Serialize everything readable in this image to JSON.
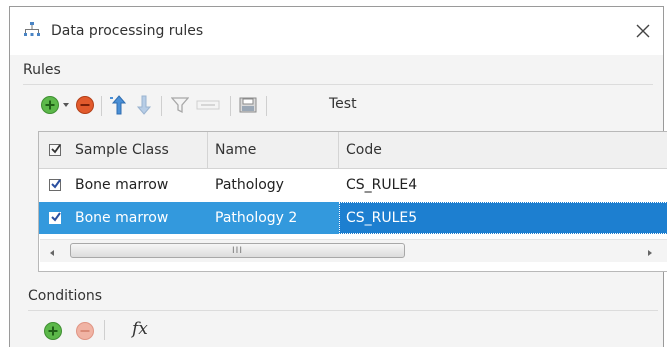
{
  "window": {
    "title": "Data processing rules",
    "close_icon": "close-icon"
  },
  "rules": {
    "label": "Rules",
    "toolbar": {
      "test_label": "Test",
      "icons": [
        "add-icon",
        "dropdown-arrow-icon",
        "remove-icon",
        "move-up-icon",
        "move-down-icon",
        "filter-icon",
        "disabled-icon",
        "export-icon"
      ]
    },
    "grid": {
      "columns": [
        "Sample Class",
        "Name",
        "Code"
      ],
      "rows": [
        {
          "checked": true,
          "sample_class": "Bone marrow",
          "name": "Pathology",
          "code": "CS_RULE4",
          "selected": false
        },
        {
          "checked": true,
          "sample_class": "Bone marrow",
          "name": "Pathology 2",
          "code": "CS_RULE5",
          "selected": true
        }
      ],
      "scroll_grip": "III"
    }
  },
  "conditions": {
    "label": "Conditions",
    "fx_label": "fx"
  },
  "colors": {
    "selection": "#3399dd",
    "add_green": "#5cb84a",
    "remove_red": "#e25a2c"
  }
}
